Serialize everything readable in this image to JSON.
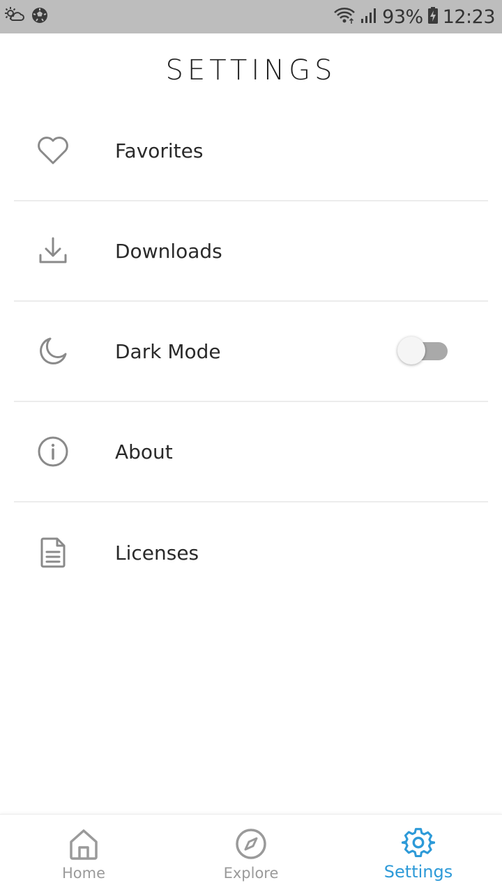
{
  "status_bar": {
    "battery_percent": "93%",
    "time": "12:23"
  },
  "title": "SETTINGS",
  "settings": {
    "items": [
      {
        "label": "Favorites",
        "icon": "heart-icon"
      },
      {
        "label": "Downloads",
        "icon": "download-icon"
      },
      {
        "label": "Dark Mode",
        "icon": "moon-icon",
        "toggle_on": false
      },
      {
        "label": "About",
        "icon": "info-icon"
      },
      {
        "label": "Licenses",
        "icon": "document-icon"
      }
    ]
  },
  "bottom_nav": {
    "tabs": [
      {
        "label": "Home",
        "icon": "home-icon",
        "active": false
      },
      {
        "label": "Explore",
        "icon": "compass-icon",
        "active": false
      },
      {
        "label": "Settings",
        "icon": "gear-icon",
        "active": true
      }
    ]
  },
  "colors": {
    "accent": "#2d9ad8",
    "icon_gray": "#8a8a8a",
    "status_bar_bg": "#bdbdbd",
    "toggle_track": "#a9a9a9"
  }
}
